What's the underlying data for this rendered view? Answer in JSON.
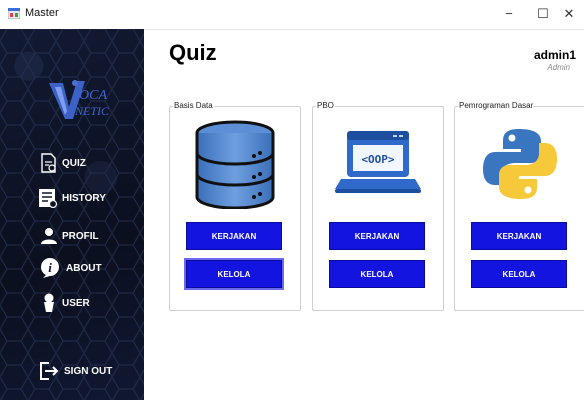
{
  "window": {
    "title": "Master",
    "minimize": "−",
    "maximize": "☐",
    "close": "✕"
  },
  "sidebar": {
    "logo_text": "VOCANETIC",
    "items": [
      {
        "label": "QUIZ",
        "icon": "quiz-icon"
      },
      {
        "label": "HISTORY",
        "icon": "history-icon"
      },
      {
        "label": "PROFIL",
        "icon": "person-icon"
      },
      {
        "label": "ABOUT",
        "icon": "info-icon"
      },
      {
        "label": "USER",
        "icon": "user-icon"
      },
      {
        "label": "SIGN OUT",
        "icon": "sign-out-icon"
      }
    ]
  },
  "header": {
    "title": "Quiz",
    "user_name": "admin1",
    "user_role": "Admin"
  },
  "cards": [
    {
      "title": "Basis Data",
      "icon": "database-icon",
      "primary": "KERJAKAN",
      "secondary": "KELOLA"
    },
    {
      "title": "PBO",
      "icon": "oop-icon",
      "primary": "KERJAKAN",
      "secondary": "KELOLA",
      "badge": "<OOP>"
    },
    {
      "title": "Pemrograman Dasar",
      "icon": "python-icon",
      "primary": "KERJAKAN",
      "secondary": "KELOLA"
    }
  ],
  "colors": {
    "sidebar_bg": "#0e1427",
    "button_bg": "#1414e0",
    "button_text": "#ffffff"
  }
}
